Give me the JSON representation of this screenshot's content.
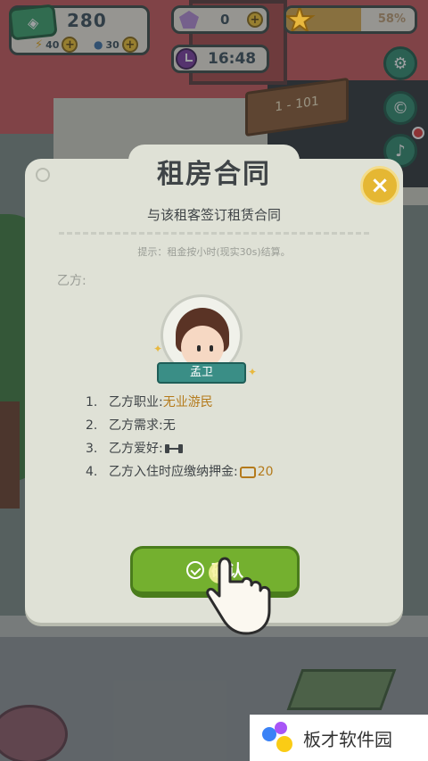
{
  "hud": {
    "cash": "280",
    "energy": "40",
    "water": "30",
    "gems": "0",
    "star_percent": "58%",
    "star_progress": 0.58,
    "clock": "16:48"
  },
  "scene": {
    "sign_text": "1 - 101"
  },
  "side_buttons": [
    "gear-icon",
    "coin-icon",
    "bell-icon"
  ],
  "dialog": {
    "title": "租房合同",
    "subtitle": "与该租客签订租赁合同",
    "hint": "提示：租金按小时(现实30s)结算。",
    "party_b_label": "乙方:",
    "tenant_name": "孟卫",
    "terms": [
      {
        "num": "1.",
        "label": "乙方职业:",
        "value": "无业游民"
      },
      {
        "num": "2.",
        "label": "乙方需求:",
        "value": "无"
      },
      {
        "num": "3.",
        "label": "乙方爱好:",
        "value": ""
      },
      {
        "num": "4.",
        "label": "乙方入住时应缴纳押金:",
        "value": "20"
      }
    ],
    "confirm_label": "确认",
    "close_label": "×"
  },
  "watermark": {
    "text": "板才软件园"
  },
  "colors": {
    "confirm": "#74b02f",
    "highlight": "#b47a1b",
    "close": "#e5b733"
  }
}
